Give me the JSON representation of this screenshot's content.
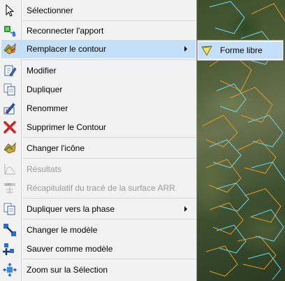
{
  "menu": {
    "items": [
      {
        "label": "Sélectionner",
        "icon": "cursor-arrow-icon"
      },
      {
        "label": "Reconnecter l'apport",
        "icon": "reconnect-icon"
      },
      {
        "label": "Remplacer le contour",
        "icon": "replace-contour-icon",
        "selected": true,
        "has_submenu": true
      },
      {
        "label": "Modifier",
        "icon": "edit-icon"
      },
      {
        "label": "Dupliquer",
        "icon": "duplicate-icon"
      },
      {
        "label": "Renommer",
        "icon": "rename-icon"
      },
      {
        "label": "Supprimer le Contour",
        "icon": "delete-icon"
      },
      {
        "label": "Changer l'icône",
        "icon": "change-icon-icon"
      },
      {
        "label": "Résultats",
        "icon": "results-icon",
        "disabled": true
      },
      {
        "label": "Récapitulatif du tracé de la surface ARR",
        "icon": "summary-icon",
        "disabled": true
      },
      {
        "label": "Dupliquer vers la phase",
        "icon": "duplicate-phase-icon",
        "has_submenu": true
      },
      {
        "label": "Changer le modèle",
        "icon": "change-model-icon"
      },
      {
        "label": "Sauver comme modèle",
        "icon": "save-model-icon"
      },
      {
        "label": "Zoom sur la Sélection",
        "icon": "zoom-selection-icon"
      }
    ]
  },
  "submenu": {
    "items": [
      {
        "label": "Forme libre",
        "icon": "freeform-shape-icon"
      }
    ]
  },
  "colors": {
    "selection": "#c4dff8",
    "menu_background": "#f2f2f2",
    "contour_orange": "#e09a2a",
    "contour_cyan": "#6fd6e8"
  }
}
